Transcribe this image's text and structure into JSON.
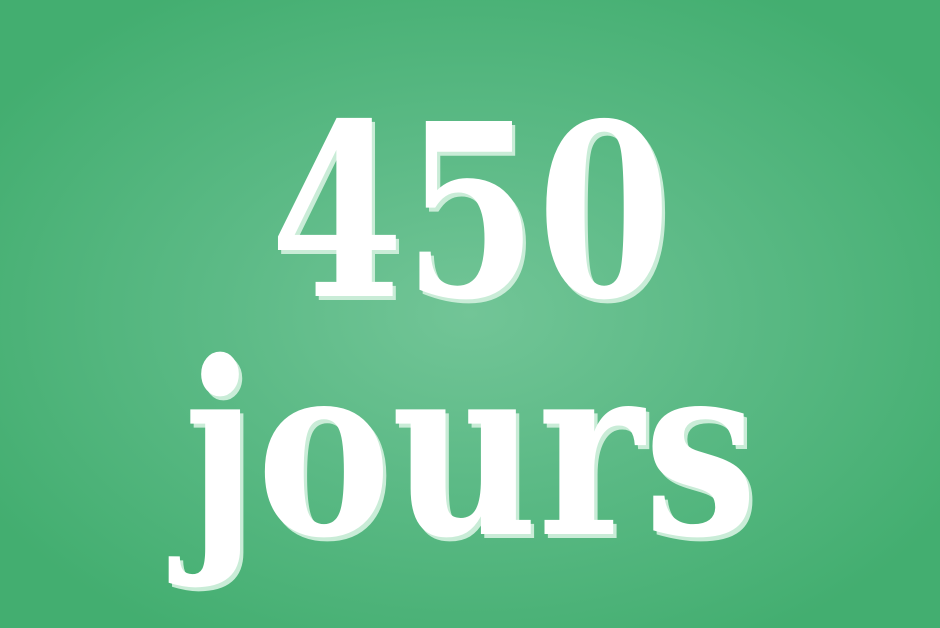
{
  "headline": {
    "number": "450",
    "unit": "jours"
  },
  "colors": {
    "background_center": "#72c597",
    "background_edge": "#43ae70",
    "text": "#ffffff",
    "text_shadow": "#c9ecd7"
  }
}
